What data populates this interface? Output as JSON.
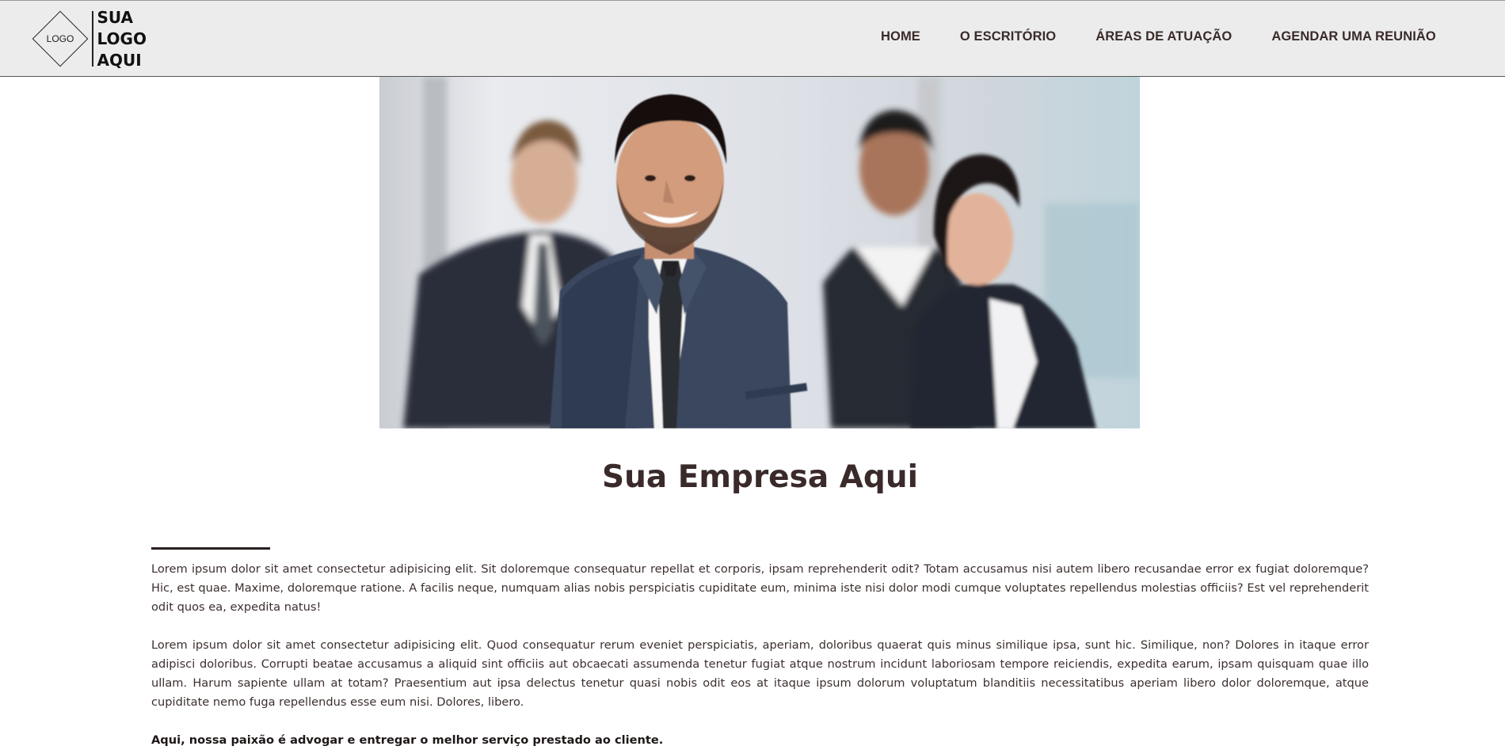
{
  "header": {
    "logo_icon_text": "LOGO",
    "logo_text": "SUA LOGO AQUI",
    "nav": [
      {
        "label": "HOME"
      },
      {
        "label": "O ESCRITÓRIO"
      },
      {
        "label": "ÁREAS DE ATUAÇÃO"
      },
      {
        "label": "AGENDAR UMA REUNIÃO"
      }
    ]
  },
  "hero": {
    "image_icon": "team-photo"
  },
  "main": {
    "title": "Sua Empresa Aqui",
    "paragraphs": [
      "Lorem ipsum dolor sit amet consectetur adipisicing elit. Sit doloremque consequatur repellat et corporis, ipsam reprehenderit odit? Totam accusamus nisi autem libero recusandae error ex fugiat doloremque? Hic, est quae. Maxime, doloremque ratione. A facilis neque, numquam alias nobis perspiciatis cupiditate eum, minima iste nisi dolor modi cumque voluptates repellendus molestias officiis? Est vel reprehenderit odit quos ea, expedita natus!",
      "Lorem ipsum dolor sit amet consectetur adipisicing elit. Quod consequatur rerum eveniet perspiciatis, aperiam, doloribus quaerat quis minus similique ipsa, sunt hic. Similique, non? Dolores in itaque error adipisci doloribus. Corrupti beatae accusamus a aliquid sint officiis aut obcaecati assumenda tenetur fugiat atque nostrum incidunt laboriosam tempore reiciendis, expedita earum, ipsam quisquam quae illo ullam. Harum sapiente ullam at totam? Praesentium aut ipsa delectus tenetur quasi nobis odit eos at itaque ipsum dolorum voluptatum blanditiis necessitatibus aperiam libero dolor doloremque, atque cupiditate nemo fuga repellendus esse eum nisi. Dolores, libero."
    ],
    "bold_line": "Aqui, nossa paixão é advogar e entregar o melhor serviço prestado ao cliente."
  },
  "colors": {
    "header_bg": "#ececec",
    "text": "#3a2a2a",
    "divider": "#2a1f1f"
  }
}
